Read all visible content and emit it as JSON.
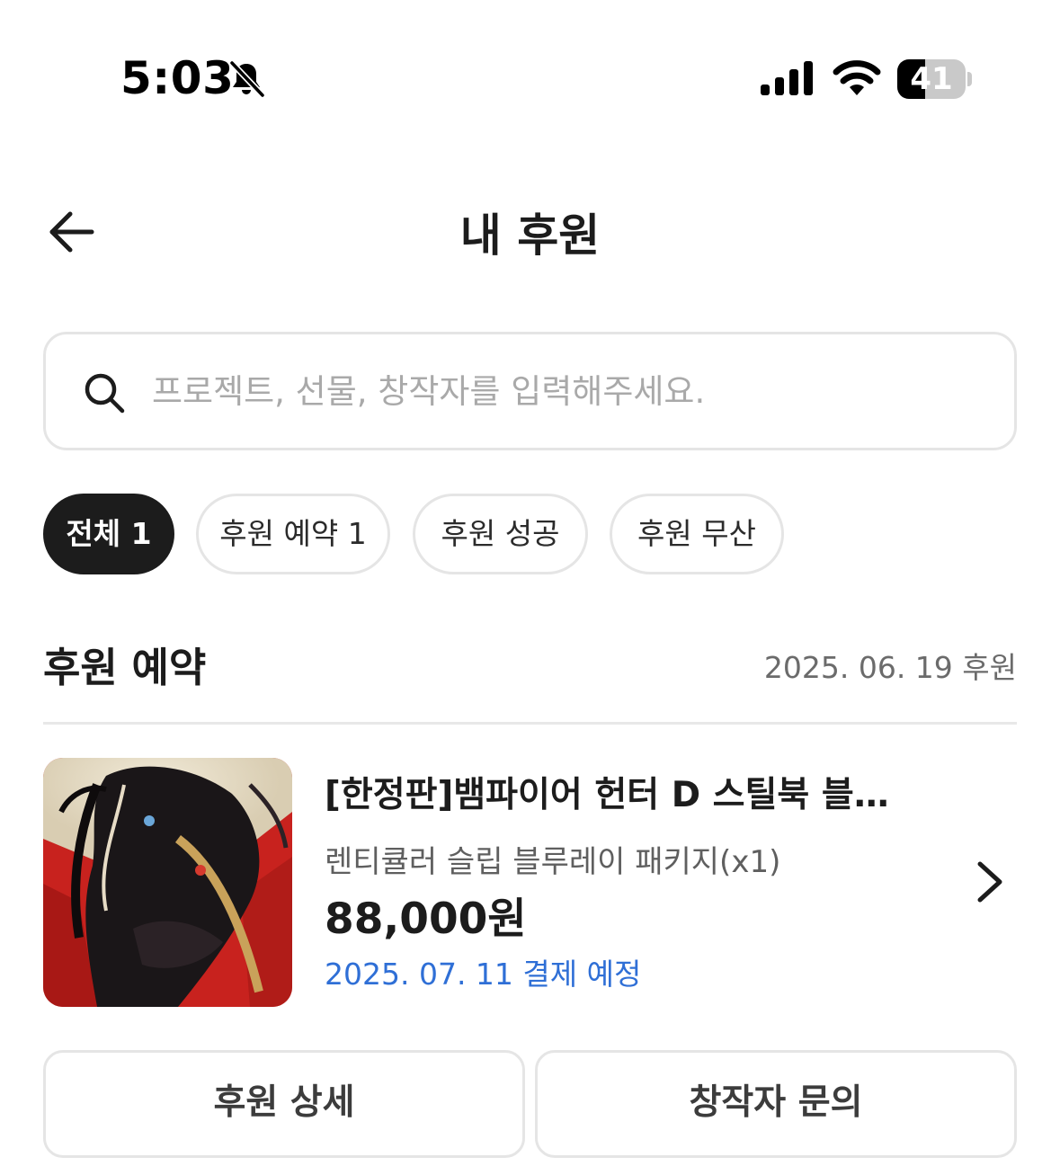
{
  "status_bar": {
    "time": "5:03",
    "battery_level": "41",
    "battery_fraction": 0.41,
    "icons": [
      "bell-slash-icon",
      "cellular-signal-icon",
      "wifi-icon",
      "battery-icon"
    ]
  },
  "header": {
    "title": "내 후원",
    "back_icon": "arrow-left-icon"
  },
  "search": {
    "placeholder": "프로젝트, 선물, 창작자를 입력해주세요.",
    "value": "",
    "icon": "search-icon"
  },
  "filters": [
    {
      "label": "전체 1",
      "active": true
    },
    {
      "label": "후원 예약 1",
      "active": false
    },
    {
      "label": "후원 성공",
      "active": false
    },
    {
      "label": "후원 무산",
      "active": false
    }
  ],
  "section": {
    "title": "후원 예약",
    "date": "2025. 06. 19 후원"
  },
  "item": {
    "title": "[한정판]뱀파이어 헌터 D 스틸북 블루레이 패키지",
    "option": "렌티큘러 슬립 블루레이 패키지(x1)",
    "price": "88,000원",
    "payment": "2025. 07. 11 결제 예정",
    "thumbnail": "vampire-hunter-d-artwork",
    "chevron_icon": "chevron-right-icon"
  },
  "actions": {
    "detail_label": "후원 상세",
    "inquiry_label": "창작자 문의"
  },
  "colors": {
    "accent_blue": "#2f6fd6",
    "chip_active": "#1c1c1c",
    "border": "#e5e5e5"
  }
}
